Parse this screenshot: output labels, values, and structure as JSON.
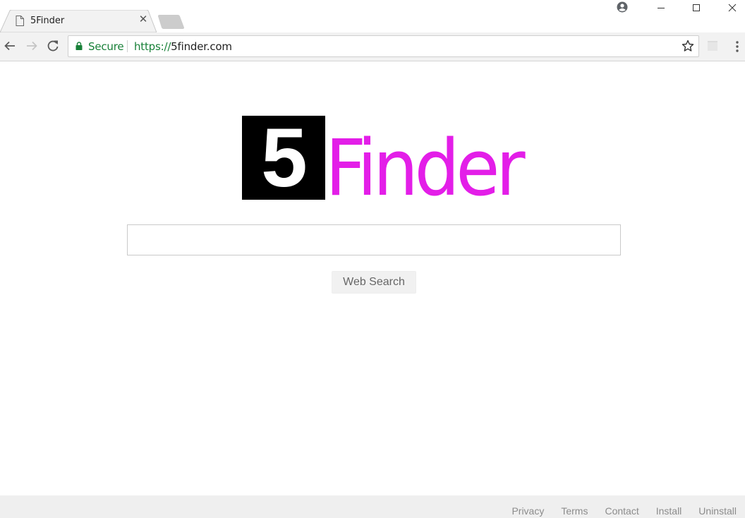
{
  "browser": {
    "tab": {
      "title": "5Finder",
      "icon": "page-icon",
      "close_icon": "close-icon"
    },
    "new_tab_icon": "new-tab-icon",
    "window_controls": {
      "profile_icon": "profile-icon",
      "minimize_icon": "minimize-icon",
      "maximize_icon": "maximize-icon",
      "close_icon": "close-icon"
    },
    "toolbar": {
      "back_icon": "back-arrow-icon",
      "forward_icon": "forward-arrow-icon",
      "reload_icon": "reload-icon",
      "security_label": "Secure",
      "url_scheme": "https://",
      "url_host": "5finder.com",
      "bookmark_icon": "star-icon",
      "extension_icon": "extension-icon",
      "menu_icon": "more-vertical-icon"
    },
    "colors": {
      "secure_green": "#188038",
      "toolbar_bg": "#f2f2f2"
    }
  },
  "page": {
    "logo": {
      "digit": "5",
      "word": "Finder",
      "box_color": "#000000",
      "word_color": "#e31ee8"
    },
    "search": {
      "value": "",
      "placeholder": "",
      "button_label": "Web Search"
    },
    "footer": {
      "links": [
        "Privacy",
        "Terms",
        "Contact",
        "Install",
        "Uninstall"
      ]
    }
  }
}
